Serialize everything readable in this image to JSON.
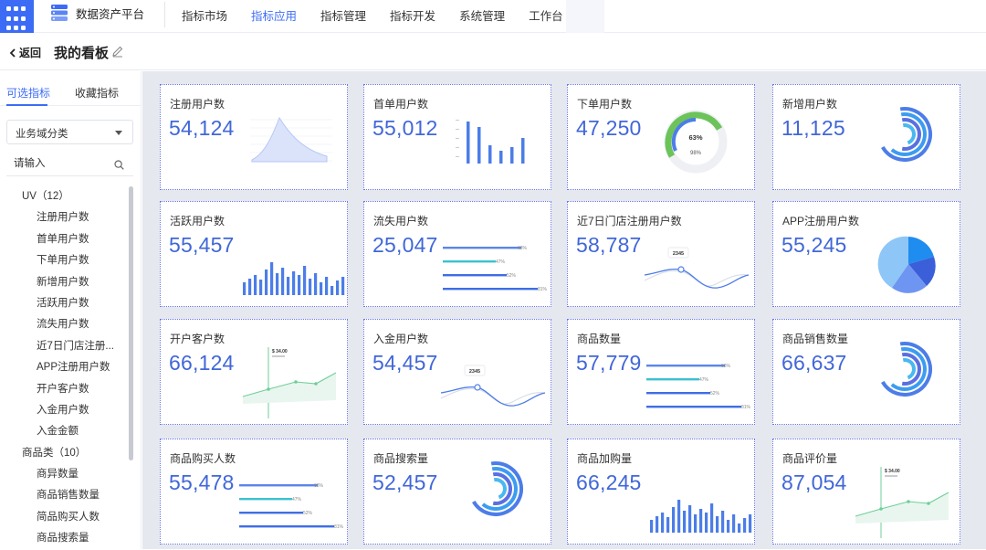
{
  "topbar": {
    "brand": "数据资产平台",
    "nav": [
      {
        "label": "指标市场",
        "active": false
      },
      {
        "label": "指标应用",
        "active": true
      },
      {
        "label": "指标管理",
        "active": false
      },
      {
        "label": "指标开发",
        "active": false
      },
      {
        "label": "系统管理",
        "active": false
      },
      {
        "label": "工作台",
        "active": false
      }
    ],
    "accent": "#3c6cf5"
  },
  "subhead": {
    "back_label": "返回",
    "title": "我的看板"
  },
  "sidebar": {
    "tabs": [
      "可选指标",
      "收藏指标"
    ],
    "category_select": "业务域分类",
    "search_placeholder": "请输入",
    "tree": [
      {
        "type": "group",
        "label": "UV（12）"
      },
      {
        "type": "leaf",
        "label": "注册用户数"
      },
      {
        "type": "leaf",
        "label": "首单用户数"
      },
      {
        "type": "leaf",
        "label": "下单用户数"
      },
      {
        "type": "leaf",
        "label": "新增用户数"
      },
      {
        "type": "leaf",
        "label": "活跃用户数"
      },
      {
        "type": "leaf",
        "label": "流失用户数"
      },
      {
        "type": "leaf",
        "label": "近7日门店注册..."
      },
      {
        "type": "leaf",
        "label": "APP注册用户数"
      },
      {
        "type": "leaf",
        "label": "开户客户数"
      },
      {
        "type": "leaf",
        "label": "入金用户数"
      },
      {
        "type": "leaf",
        "label": "入金金额"
      },
      {
        "type": "group",
        "label": "商品类（10）"
      },
      {
        "type": "leaf",
        "label": "商异数量"
      },
      {
        "type": "leaf",
        "label": "商品销售数量"
      },
      {
        "type": "leaf",
        "label": "简品购买人数"
      },
      {
        "type": "leaf",
        "label": "商品搜索量"
      }
    ]
  },
  "cards": [
    {
      "title": "注册用户数",
      "value": "54,124",
      "viz": "area"
    },
    {
      "title": "首单用户数",
      "value": "55,012",
      "viz": "bars-sparse"
    },
    {
      "title": "下单用户数",
      "value": "47,250",
      "viz": "gauge",
      "gauge_text": "63%",
      "gauge_sub": "98%"
    },
    {
      "title": "新增用户数",
      "value": "11,125",
      "viz": "rings"
    },
    {
      "title": "活跃用户数",
      "value": "55,457",
      "viz": "bars-dense"
    },
    {
      "title": "流失用户数",
      "value": "25,047",
      "viz": "hbars",
      "hbar_labels": [
        "63%",
        "47%",
        "52%",
        "81%"
      ]
    },
    {
      "title": "近7日门店注册用户数",
      "value": "58,787",
      "viz": "wave",
      "tip": "2345"
    },
    {
      "title": "APP注册用户数",
      "value": "55,245",
      "viz": "pie3d"
    },
    {
      "title": "开户客户数",
      "value": "66,124",
      "viz": "linecross",
      "tip": "$ 34.00"
    },
    {
      "title": "入金用户数",
      "value": "54,457",
      "viz": "wave",
      "tip": "2345"
    },
    {
      "title": "商品数量",
      "value": "57,779",
      "viz": "hbars",
      "hbar_labels": [
        "63%",
        "47%",
        "52%",
        "81%"
      ]
    },
    {
      "title": "商品销售数量",
      "value": "66,637",
      "viz": "rings"
    },
    {
      "title": "商品购买人数",
      "value": "55,478",
      "viz": "hbars",
      "hbar_labels": [
        "63%",
        "47%",
        "52%",
        "81%"
      ]
    },
    {
      "title": "商品搜索量",
      "value": "52,457",
      "viz": "rings"
    },
    {
      "title": "商品加购量",
      "value": "66,245",
      "viz": "bars-dense"
    },
    {
      "title": "商品评价量",
      "value": "87,054",
      "viz": "linecross",
      "tip": "$ 34.00"
    }
  ]
}
